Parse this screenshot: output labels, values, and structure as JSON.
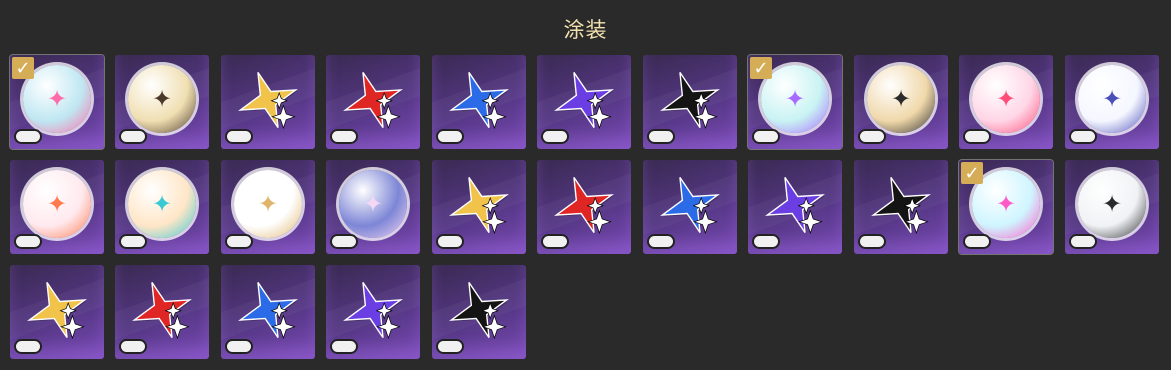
{
  "title": "涂装",
  "items": [
    {
      "id": "r1c1",
      "kind": "emblem",
      "color": "#bfe7f2",
      "accent": "#ff6da8",
      "icon": "wave-emblem-icon",
      "selected": true
    },
    {
      "id": "r1c2",
      "kind": "emblem",
      "color": "#f0dfb2",
      "accent": "#4b3a2a",
      "icon": "character-portrait-icon",
      "selected": false
    },
    {
      "id": "r1c3",
      "kind": "star",
      "color": "#f1c34a",
      "selected": false
    },
    {
      "id": "r1c4",
      "kind": "star",
      "color": "#e02525",
      "selected": false
    },
    {
      "id": "r1c5",
      "kind": "star",
      "color": "#2b6be8",
      "selected": false
    },
    {
      "id": "r1c6",
      "kind": "star",
      "color": "#6b3ee3",
      "selected": false
    },
    {
      "id": "r1c7",
      "kind": "star",
      "color": "#141414",
      "selected": false
    },
    {
      "id": "r1c8",
      "kind": "emblem",
      "color": "#c9f3f3",
      "accent": "#a76bff",
      "icon": "flower-emblem-icon",
      "selected": true
    },
    {
      "id": "r1c9",
      "kind": "emblem",
      "color": "#f0d8aa",
      "accent": "#2b2b2b",
      "icon": "ring-emblem-icon",
      "selected": false
    },
    {
      "id": "r1c10",
      "kind": "emblem",
      "color": "#ffd6e6",
      "accent": "#ff4d7a",
      "icon": "pink-portrait-icon",
      "selected": false
    },
    {
      "id": "r1c11",
      "kind": "emblem",
      "color": "#f5f7ff",
      "accent": "#4b4fb8",
      "icon": "winged-emblem-icon",
      "selected": false
    },
    {
      "id": "r2c1",
      "kind": "emblem",
      "color": "#ffe9ee",
      "accent": "#ff7a4d",
      "icon": "party-emblem-icon",
      "selected": false
    },
    {
      "id": "r2c2",
      "kind": "emblem",
      "color": "#ffe6c7",
      "accent": "#39c9d3",
      "icon": "crystal-emblem-icon",
      "selected": false
    },
    {
      "id": "r2c3",
      "kind": "emblem",
      "color": "#ffffff",
      "accent": "#e0b56b",
      "icon": "chibi-portrait-icon",
      "selected": false
    },
    {
      "id": "r2c4",
      "kind": "emblem",
      "color": "#7d86d6",
      "accent": "#f3d7f3",
      "icon": "chibi-character-icon",
      "selected": false
    },
    {
      "id": "r2c5",
      "kind": "star",
      "color": "#f1c34a",
      "selected": false
    },
    {
      "id": "r2c6",
      "kind": "star",
      "color": "#e02525",
      "selected": false
    },
    {
      "id": "r2c7",
      "kind": "star",
      "color": "#2b6be8",
      "selected": false
    },
    {
      "id": "r2c8",
      "kind": "star",
      "color": "#6b3ee3",
      "selected": false
    },
    {
      "id": "r2c9",
      "kind": "star",
      "color": "#141414",
      "selected": false
    },
    {
      "id": "r2c10",
      "kind": "emblem",
      "color": "#cff5ff",
      "accent": "#ff59c8",
      "icon": "cat-emblem-icon",
      "selected": true
    },
    {
      "id": "r2c11",
      "kind": "emblem",
      "color": "#f0f2f5",
      "accent": "#2b2b2b",
      "icon": "dark-portrait-icon",
      "selected": false
    },
    {
      "id": "r3c1",
      "kind": "star",
      "color": "#f1c34a",
      "selected": false
    },
    {
      "id": "r3c2",
      "kind": "star",
      "color": "#e02525",
      "selected": false
    },
    {
      "id": "r3c3",
      "kind": "star",
      "color": "#2b6be8",
      "selected": false
    },
    {
      "id": "r3c4",
      "kind": "star",
      "color": "#6b3ee3",
      "selected": false
    },
    {
      "id": "r3c5",
      "kind": "star",
      "color": "#141414",
      "selected": false
    }
  ],
  "icons": {
    "check": "checkmark-icon",
    "shoe": "sneaker-icon"
  }
}
